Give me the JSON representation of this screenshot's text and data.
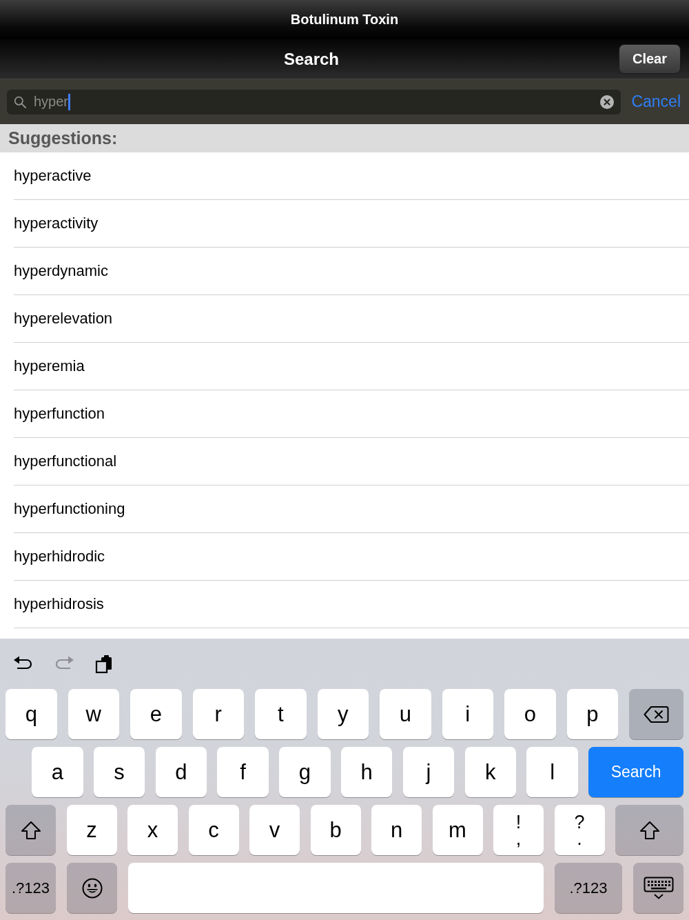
{
  "title_bar": {
    "title": "Botulinum Toxin"
  },
  "nav_bar": {
    "title": "Search",
    "clear_button": "Clear"
  },
  "search_bar": {
    "value": "hyper",
    "focused": true,
    "cancel_button": "Cancel"
  },
  "suggestions": {
    "header": "Suggestions:",
    "items": [
      "hyperactive",
      "hyperactivity",
      "hyperdynamic",
      "hyperelevation",
      "hyperemia",
      "hyperfunction",
      "hyperfunctional",
      "hyperfunctioning",
      "hyperhidrodic",
      "hyperhidrosis"
    ]
  },
  "keyboard": {
    "toolbar": [
      {
        "kind": "undo",
        "disabled": false
      },
      {
        "kind": "redo",
        "disabled": true
      },
      {
        "kind": "copy",
        "disabled": false
      }
    ],
    "key_rows": [
      {
        "keys": [
          {
            "kind": "letter",
            "label": "q"
          },
          {
            "kind": "letter",
            "label": "w"
          },
          {
            "kind": "letter",
            "label": "e"
          },
          {
            "kind": "letter",
            "label": "r"
          },
          {
            "kind": "letter",
            "label": "t"
          },
          {
            "kind": "letter",
            "label": "y"
          },
          {
            "kind": "letter",
            "label": "u"
          },
          {
            "kind": "letter",
            "label": "i"
          },
          {
            "kind": "letter",
            "label": "o"
          },
          {
            "kind": "letter",
            "label": "p"
          },
          {
            "kind": "delete"
          }
        ]
      },
      {
        "keys": [
          {
            "kind": "letter",
            "label": "a"
          },
          {
            "kind": "letter",
            "label": "s"
          },
          {
            "kind": "letter",
            "label": "d"
          },
          {
            "kind": "letter",
            "label": "f"
          },
          {
            "kind": "letter",
            "label": "g"
          },
          {
            "kind": "letter",
            "label": "h"
          },
          {
            "kind": "letter",
            "label": "j"
          },
          {
            "kind": "letter",
            "label": "k"
          },
          {
            "kind": "letter",
            "label": "l"
          },
          {
            "kind": "return",
            "label": "Search"
          }
        ]
      },
      {
        "keys": [
          {
            "kind": "shift"
          },
          {
            "kind": "letter",
            "label": "z"
          },
          {
            "kind": "letter",
            "label": "x"
          },
          {
            "kind": "letter",
            "label": "c"
          },
          {
            "kind": "letter",
            "label": "v"
          },
          {
            "kind": "letter",
            "label": "b"
          },
          {
            "kind": "letter",
            "label": "n"
          },
          {
            "kind": "letter",
            "label": "m"
          },
          {
            "kind": "dual",
            "top": "!",
            "bottom": ","
          },
          {
            "kind": "dual",
            "top": "?",
            "bottom": "."
          },
          {
            "kind": "shift"
          }
        ]
      },
      {
        "keys": [
          {
            "kind": "mode",
            "label": ".?123"
          },
          {
            "kind": "emoji"
          },
          {
            "kind": "space"
          },
          {
            "kind": "mode",
            "label": ".?123"
          },
          {
            "kind": "dismiss"
          }
        ]
      }
    ]
  }
}
